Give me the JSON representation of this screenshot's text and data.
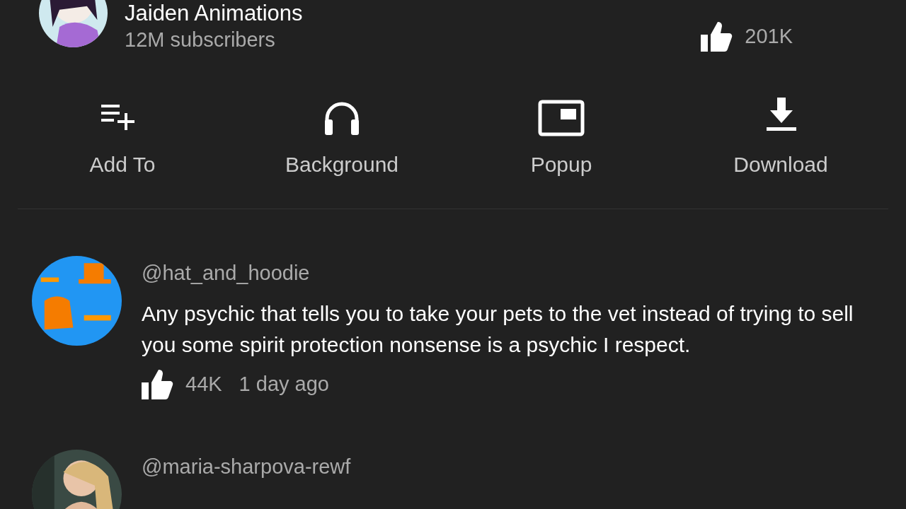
{
  "channel": {
    "name": "Jaiden Animations",
    "subscribers": "12M subscribers",
    "likes": "201K"
  },
  "actions": [
    {
      "label": "Add To",
      "kind": "add"
    },
    {
      "label": "Background",
      "kind": "headphones"
    },
    {
      "label": "Popup",
      "kind": "popup"
    },
    {
      "label": "Download",
      "kind": "download"
    }
  ],
  "comments": [
    {
      "author": "@hat_and_hoodie",
      "text": "Any psychic that tells you to take your pets to the vet instead of trying to sell you some spirit protection nonsense is a psychic I respect.",
      "likes": "44K",
      "time": "1 day ago"
    },
    {
      "author": "@maria-sharpova-rewf"
    }
  ]
}
